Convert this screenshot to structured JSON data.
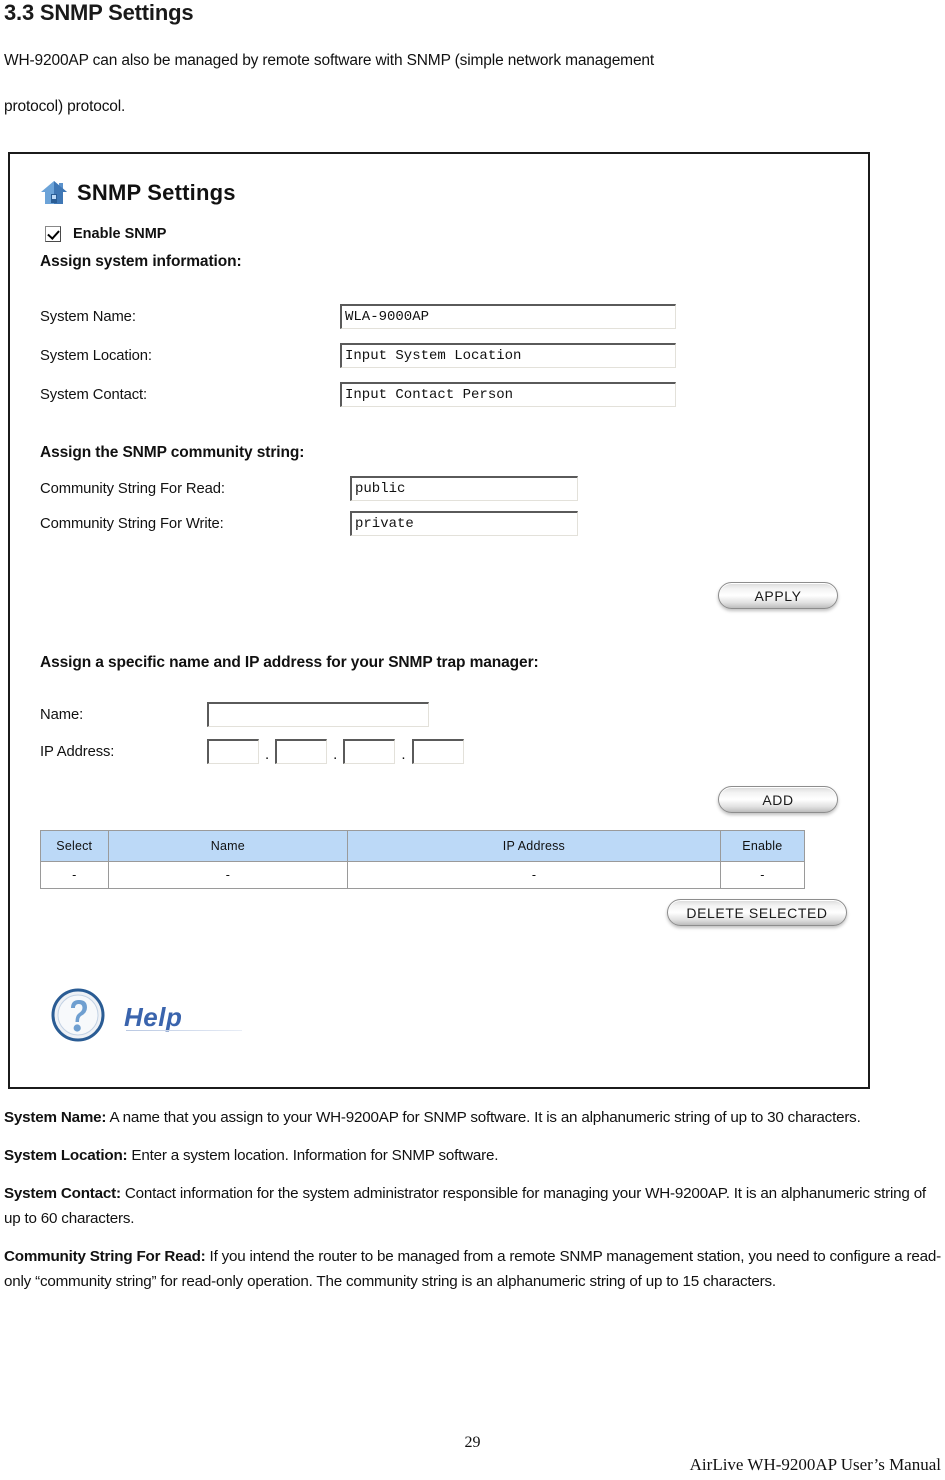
{
  "document": {
    "heading": "3.3 SNMP Settings",
    "intro_line1": "WH-9200AP can also be managed by remote software with SNMP (simple network management",
    "intro_line2": "protocol) protocol.",
    "definitions": [
      {
        "term": "System Name:",
        "text": " A name that you assign to your WH-9200AP for SNMP software. It is an alphanumeric string of up to 30 characters."
      },
      {
        "term": "System Location:",
        "text": " Enter a system location. Information for SNMP software."
      },
      {
        "term": "System Contact:",
        "text": " Contact information for the system administrator responsible for managing your WH-9200AP. It is an alphanumeric string of up to 60 characters."
      },
      {
        "term": "Community String For Read:",
        "text": " If you intend the router to be managed from a remote SNMP management station, you need to configure a read-only “community string” for read-only operation. The community string is an alphanumeric string of up to 15 characters."
      }
    ],
    "page_number": "29",
    "footer": "AirLive WH-9200AP User’s Manual"
  },
  "ui": {
    "title": "SNMP Settings",
    "home_icon": "home-icon",
    "enable_snmp": {
      "label": "Enable SNMP",
      "checked": true
    },
    "sections": {
      "system_info_heading": "Assign system information:",
      "community_heading": "Assign the SNMP community string:",
      "trap_heading": "Assign a specific name and IP address for your SNMP trap manager:"
    },
    "fields": {
      "system_name": {
        "label": "System Name:",
        "value": "WLA-9000AP"
      },
      "system_location": {
        "label": "System Location:",
        "value": "Input System Location"
      },
      "system_contact": {
        "label": "System Contact:",
        "value": "Input Contact Person"
      },
      "community_read": {
        "label": "Community String For Read:",
        "value": "public"
      },
      "community_write": {
        "label": "Community String For Write:",
        "value": "private"
      },
      "trap_name": {
        "label": "Name:",
        "value": ""
      },
      "trap_ip": {
        "label": "IP Address:",
        "octets": [
          "",
          "",
          "",
          ""
        ],
        "separator": "."
      }
    },
    "buttons": {
      "apply": "APPLY",
      "add": "ADD",
      "delete_selected": "DELETE SELECTED"
    },
    "trap_table": {
      "headers": [
        "Select",
        "Name",
        "IP Address",
        "Enable"
      ],
      "rows": [
        [
          "-",
          "-",
          "-",
          "-"
        ]
      ]
    },
    "help": {
      "label": "Help",
      "icon": "question-mark-icon"
    },
    "colors": {
      "table_header": "#bcd9f7",
      "help_blue": "#3a64ad",
      "icon_blue": "#4a7ebb"
    }
  }
}
